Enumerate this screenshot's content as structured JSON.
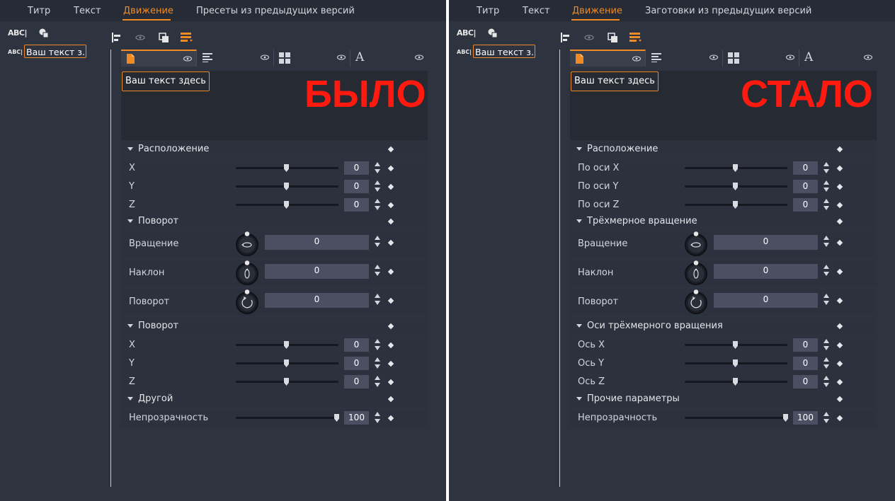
{
  "before": {
    "tabs": [
      "Титр",
      "Текст",
      "Движение",
      "Пресеты из предыдущих версий"
    ],
    "active_tab": "Движение",
    "layer_name": "Ваш текст з...",
    "preview_text": "Ваш текст здесь",
    "overlay_label": "БЫЛО",
    "sections": {
      "position": "Расположение",
      "rotation": "Поворот",
      "rotation_axes": "Поворот",
      "other": "Другой"
    },
    "position": [
      {
        "label": "X",
        "value": "0",
        "fraction": 0.5
      },
      {
        "label": "Y",
        "value": "0",
        "fraction": 0.5
      },
      {
        "label": "Z",
        "value": "0",
        "fraction": 0.5
      }
    ],
    "rotation": [
      {
        "label": "Вращение",
        "value": "0"
      },
      {
        "label": "Наклон",
        "value": "0"
      },
      {
        "label": "Поворот",
        "value": "0"
      }
    ],
    "axes": [
      {
        "label": "X",
        "value": "0",
        "fraction": 0.5
      },
      {
        "label": "Y",
        "value": "0",
        "fraction": 0.5
      },
      {
        "label": "Z",
        "value": "0",
        "fraction": 0.5
      }
    ],
    "opacity": {
      "label": "Непрозрачность",
      "value": "100",
      "fraction": 1.0
    }
  },
  "after": {
    "tabs": [
      "Титр",
      "Текст",
      "Движение",
      "Заготовки из предыдущих версий"
    ],
    "active_tab": "Движение",
    "layer_name": "Ваш текст з...",
    "preview_text": "Ваш текст здесь",
    "overlay_label": "СТАЛО",
    "sections": {
      "position": "Расположение",
      "rotation": "Трёхмерное вращение",
      "rotation_axes": "Оси трёхмерного вращения",
      "other": "Прочие параметры"
    },
    "position": [
      {
        "label": "По оси X",
        "value": "0",
        "fraction": 0.5
      },
      {
        "label": "По оси Y",
        "value": "0",
        "fraction": 0.5
      },
      {
        "label": "По оси Z",
        "value": "0",
        "fraction": 0.5
      }
    ],
    "rotation": [
      {
        "label": "Вращение",
        "value": "0"
      },
      {
        "label": "Наклон",
        "value": "0"
      },
      {
        "label": "Поворот",
        "value": "0"
      }
    ],
    "axes": [
      {
        "label": "Ось X",
        "value": "0",
        "fraction": 0.5
      },
      {
        "label": "Ось Y",
        "value": "0",
        "fraction": 0.5
      },
      {
        "label": "Ось Z",
        "value": "0",
        "fraction": 0.5
      }
    ],
    "opacity": {
      "label": "Непрозрачность",
      "value": "100",
      "fraction": 1.0
    }
  },
  "colors": {
    "accent": "#f08a24",
    "overlay": "#ff1a0f",
    "background": "#2e3340"
  },
  "icons": [
    "abc-text-tool-icon",
    "shapes-tool-icon",
    "align-left-icon",
    "eye-icon",
    "arrange-icon",
    "layer-list-icon",
    "file-icon",
    "text-align-icon",
    "layout-icon",
    "font-icon",
    "keyframe-diamond-icon"
  ]
}
